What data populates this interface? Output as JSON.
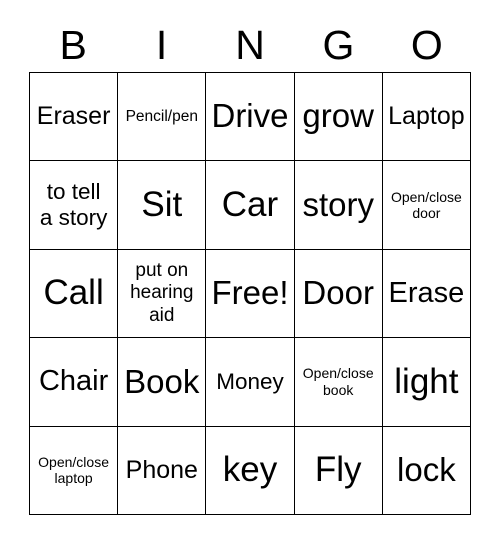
{
  "card": {
    "title": "BINGO",
    "header_letters": [
      "B",
      "I",
      "N",
      "G",
      "O"
    ],
    "free_space_label": "Free!",
    "colors": {
      "grid_line": "#000000",
      "cell_background": "#ffffff",
      "text": "#000000",
      "page_background": "#ffffff"
    },
    "rows": [
      [
        {
          "text": "Eraser",
          "size": "xl"
        },
        {
          "text": "Pencil/pen",
          "size": "sm"
        },
        {
          "text": "Drive",
          "size": "3xl"
        },
        {
          "text": "grow",
          "size": "3xl"
        },
        {
          "text": "Laptop",
          "size": "xl"
        }
      ],
      [
        {
          "text": "to tell\na story",
          "size": "lg"
        },
        {
          "text": "Sit",
          "size": "4xl"
        },
        {
          "text": "Car",
          "size": "4xl"
        },
        {
          "text": "story",
          "size": "3xl"
        },
        {
          "text": "Open/close\ndoor",
          "size": "xs"
        }
      ],
      [
        {
          "text": "Call",
          "size": "4xl"
        },
        {
          "text": "put on\nhearing\naid",
          "size": "md"
        },
        {
          "text": "Free!",
          "size": "3xl"
        },
        {
          "text": "Door",
          "size": "3xl"
        },
        {
          "text": "Erase",
          "size": "2xl"
        }
      ],
      [
        {
          "text": "Chair",
          "size": "2xl"
        },
        {
          "text": "Book",
          "size": "3xl"
        },
        {
          "text": "Money",
          "size": "lg"
        },
        {
          "text": "Open/close\nbook",
          "size": "xs"
        },
        {
          "text": "light",
          "size": "4xl"
        }
      ],
      [
        {
          "text": "Open/close\nlaptop",
          "size": "xs"
        },
        {
          "text": "Phone",
          "size": "xl"
        },
        {
          "text": "key",
          "size": "4xl"
        },
        {
          "text": "Fly",
          "size": "4xl"
        },
        {
          "text": "lock",
          "size": "3xl"
        }
      ]
    ]
  }
}
